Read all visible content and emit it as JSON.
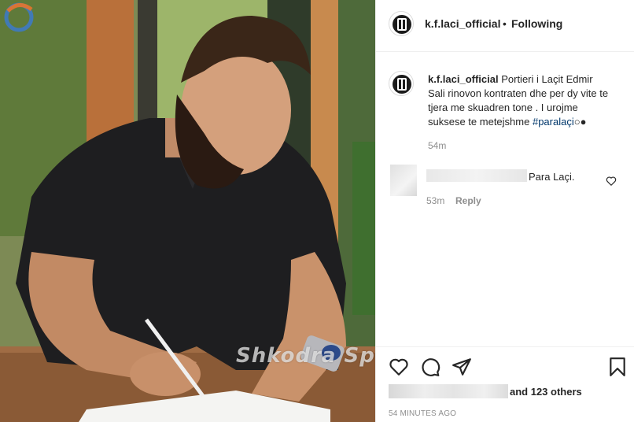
{
  "post": {
    "username": "k.f.laci_official",
    "follow_status": "Following",
    "follow_separator": "•",
    "caption": {
      "username": "k.f.laci_official",
      "text": "Portieri i Laçit Edmir Sali rinovon kontraten dhe per dy vite te tjera me skuadren tone . I urojme suksese te metejshme",
      "hashtag": "#paralaçi",
      "emoji": "○●",
      "time": "54m"
    },
    "comment": {
      "text": "Para Laçi.",
      "time": "53m",
      "reply_label": "Reply"
    },
    "likes": {
      "others_text": "and 123 others"
    },
    "timestamp": "54 MINUTES AGO"
  },
  "photo": {
    "watermark": "Shkodra Sport"
  },
  "icons": {
    "like": "heart-icon",
    "comment": "comment-icon",
    "share": "share-icon",
    "save": "bookmark-icon",
    "comment_like": "heart-icon"
  },
  "colors": {
    "text": "#262626",
    "secondary": "#8e8e8e",
    "hashtag": "#00376b",
    "border": "#efefef"
  }
}
